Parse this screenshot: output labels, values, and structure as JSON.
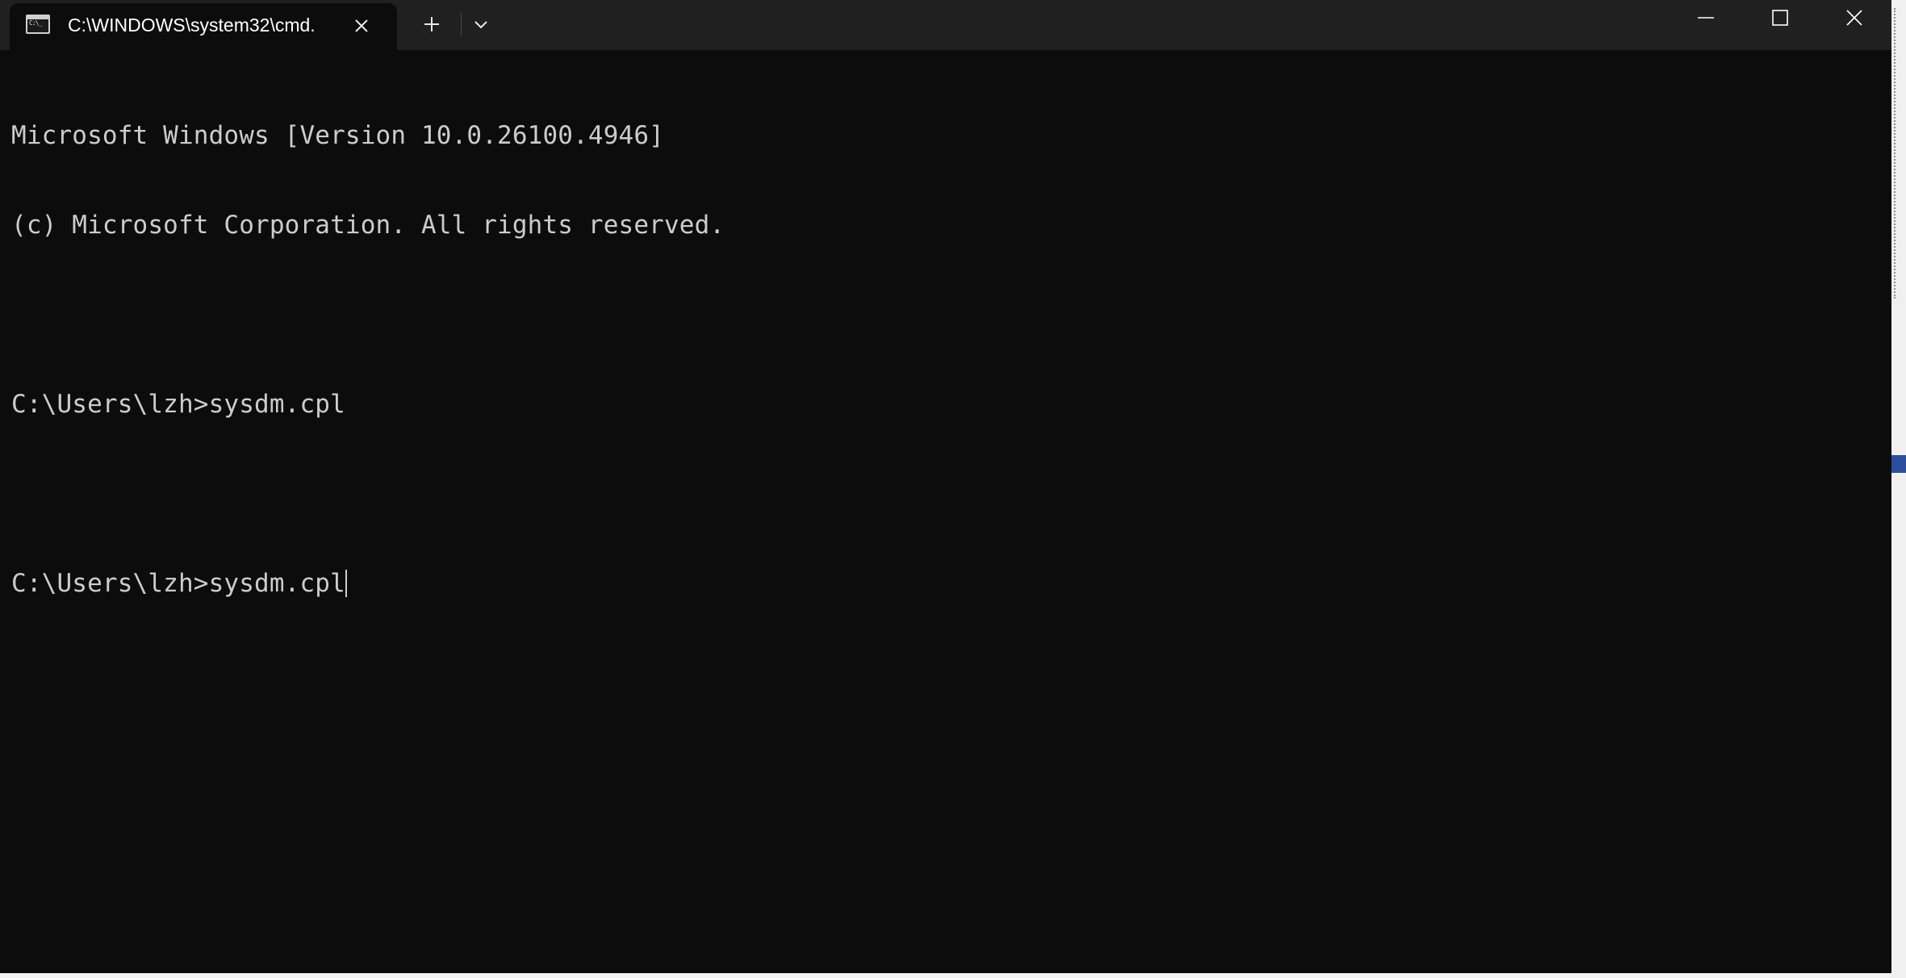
{
  "window": {
    "tab_title": "C:\\WINDOWS\\system32\\cmd.",
    "tab_icon": "cmd-terminal-icon",
    "new_tab_icon": "plus-icon",
    "dropdown_icon": "chevron-down-icon",
    "controls": [
      "minimize-icon",
      "maximize-icon",
      "close-icon"
    ]
  },
  "console": {
    "lines": [
      "Microsoft Windows [Version 10.0.26100.4946]",
      "(c) Microsoft Corporation. All rights reserved.",
      "",
      "C:\\Users\\lzh>sysdm.cpl",
      "",
      "C:\\Users\\lzh>sysdm.cpl"
    ]
  },
  "colors": {
    "titlebar": "#202020",
    "console_bg": "#0c0c0c",
    "console_text": "#cccccc"
  }
}
